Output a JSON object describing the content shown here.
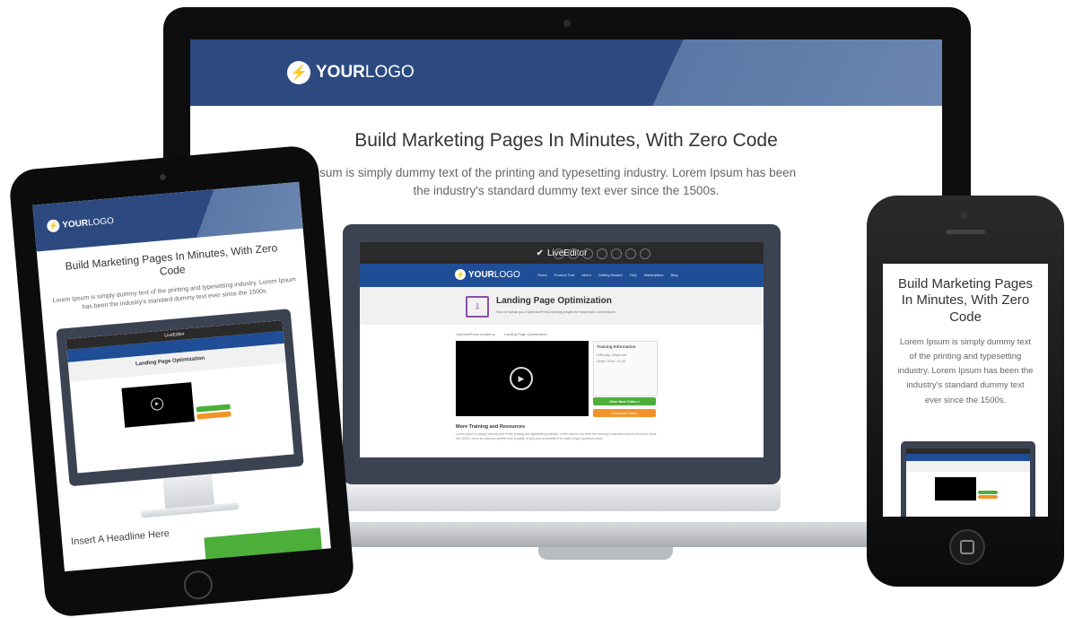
{
  "laptop": {
    "logo": {
      "strong": "YOUR",
      "light": "LOGO"
    },
    "title": "Build Marketing Pages In Minutes, With Zero Code",
    "subtitle_line1": "Ipsum is simply dummy text of the printing and typesetting industry. Lorem Ipsum has been",
    "subtitle_line2": "the industry's standard dummy text ever since the 1500s.",
    "mockup": {
      "editor_brand": "LiveEditor",
      "logo": {
        "strong": "YOUR",
        "light": "LOGO"
      },
      "nav": [
        "Home",
        "Product Tour",
        "About",
        "Getting Started",
        "FAQ",
        "Marketplace",
        "Blog"
      ],
      "page_title": "Landing Page Optimization",
      "page_subtitle": "How to tweak your OptimizePress landing pages for maximum conversions",
      "breadcrumb_a": "OptimizePress Academy",
      "breadcrumb_b": "Landing Page Optimization",
      "info_title": "Training Information",
      "info_difficulty": "Difficulty: Beginner",
      "info_video_time": "Video Time: 10:26",
      "btn_next": "View Next Video »",
      "btn_download": "Download Video",
      "section_title": "More Training and Resources",
      "body_text": "Lorem Ipsum is simply dummy text of the printing and typesetting industry. Lorem Ipsum has been the industry's standard dummy text ever since the 1500s, when an unknown printer took a galley of type and scrambled it to make a type specimen book."
    }
  },
  "tablet": {
    "logo": {
      "strong": "YOUR",
      "light": "LOGO"
    },
    "title": "Build Marketing Pages In Minutes, With Zero Code",
    "subtitle": "Lorem Ipsum is simply dummy text of the printing and typesetting industry. Lorem Ipsum has been the industry's standard dummy text ever since the 1500s.",
    "headline": "Insert A Headline Here"
  },
  "phone": {
    "title": "Build Marketing Pages In Minutes, With Zero Code",
    "subtitle": "Lorem Ipsum is simply dummy text of the printing and typesetting industry. Lorem Ipsum has been the industry's standard dummy text ever since the 1500s."
  },
  "colors": {
    "header_blue": "#2c4a80",
    "nav_blue": "#1f4e96",
    "green": "#4caf3a",
    "orange": "#f2932a"
  }
}
